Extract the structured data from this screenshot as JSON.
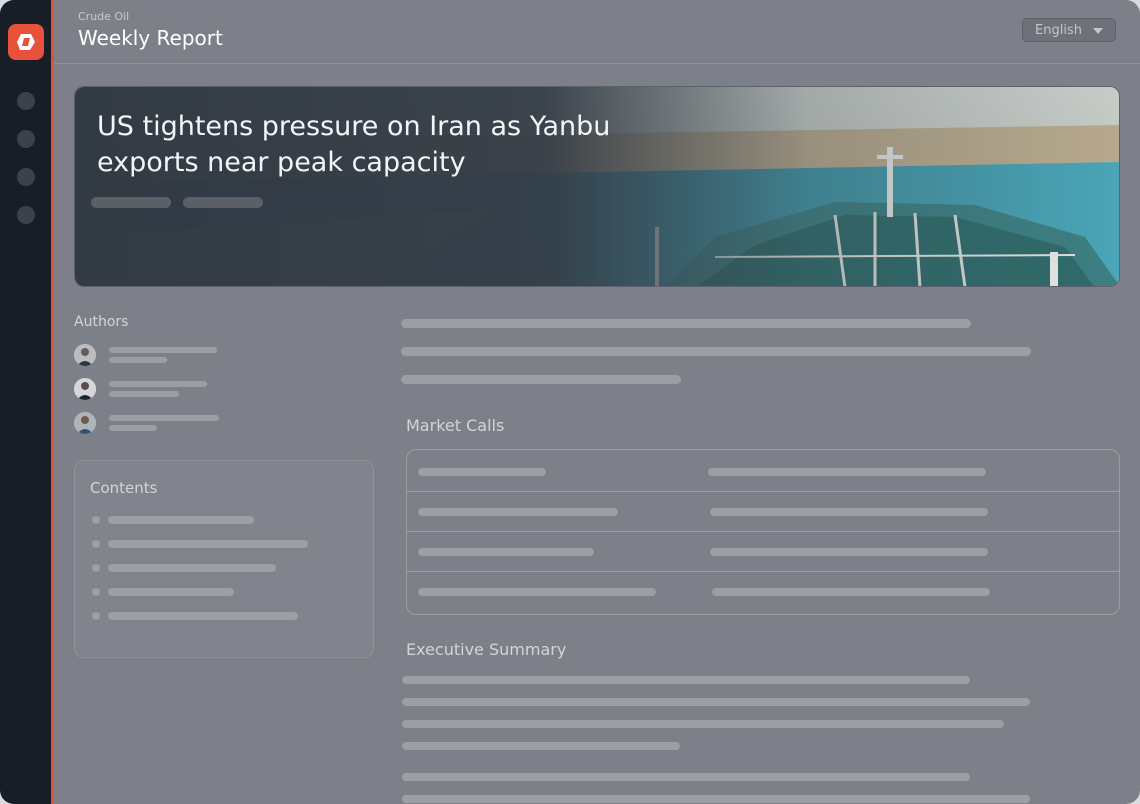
{
  "header": {
    "subtitle": "Crude Oil",
    "title": "Weekly Report",
    "language": "English"
  },
  "hero": {
    "headline": "US tightens pressure on Iran as Yanbu exports near peak capacity"
  },
  "sections": {
    "authors": "Authors",
    "contents": "Contents",
    "market_calls": "Market Calls",
    "executive_summary": "Executive Summary"
  },
  "icons": {
    "logo": "brand-logo-icon",
    "language_caret": "chevron-down-icon"
  },
  "colors": {
    "accent": "#e8523d",
    "sidebar": "#181e27"
  }
}
